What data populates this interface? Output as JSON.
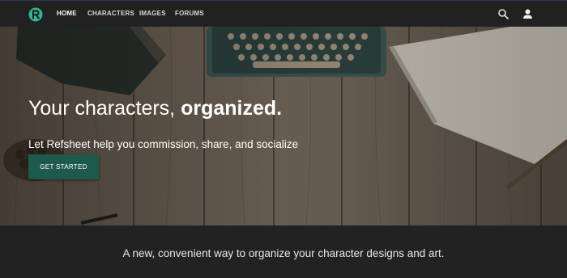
{
  "nav": {
    "links": [
      "HOME",
      "CHARACTERS",
      "IMAGES",
      "FORUMS"
    ],
    "active": "HOME",
    "icons": [
      "search-icon",
      "account-icon"
    ]
  },
  "hero": {
    "title_light": "Your characters,",
    "title_bold": "organized.",
    "subtitle": "Let Refsheet help you commission, share, and socialize",
    "cta_label": "GET STARTED"
  },
  "band": {
    "tagline": "A new, convenient way to organize your character designs and art."
  },
  "colors": {
    "brand": "#2fb39a",
    "cta": "#1d5a4b",
    "nav_bg": "#212121"
  }
}
